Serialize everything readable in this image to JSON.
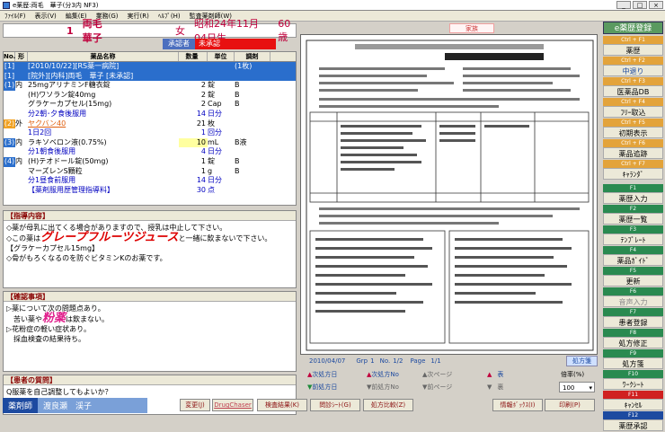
{
  "window": {
    "title": "e薬歴:両毛　華子(分3内 NF3)"
  },
  "menu": [
    "ﾌｧｲﾙ(F)",
    "表示(V)",
    "編集(E)",
    "業務(G)",
    "実行(R)",
    "ﾍﾙﾌﾟ(H)",
    "監査薬剤師(W)"
  ],
  "patient": {
    "id": "1",
    "name": "両毛　華子",
    "sex": "女",
    "birth": "昭和24年11月04日生",
    "age": "60歳",
    "family": "家族"
  },
  "approval": {
    "label": "承認者",
    "status": "未承認"
  },
  "med": {
    "headers": [
      "No.",
      "形",
      "薬品名称",
      "数量",
      "単位",
      "調剤"
    ],
    "rows": [
      {
        "c1": "[1]",
        "c2": "",
        "c3": "[2010/10/22][RS薬一病院]",
        "c4": "",
        "c5": "",
        "c6": "(1枚)",
        "cls": "rp"
      },
      {
        "c1": "[1]",
        "c2": "",
        "c3": "[院外][内科]両毛　華子 [未承認]",
        "c4": "",
        "c5": "",
        "c6": "",
        "cls": "rp"
      },
      {
        "c1": "(1)",
        "c2": "内",
        "c3": "25mgアリナミンF糖衣錠",
        "c4": "2",
        "c5": "錠",
        "c6": "B",
        "cls": ""
      },
      {
        "c1": "",
        "c2": "",
        "c3": "(H)ワソラン錠40mg",
        "c4": "2",
        "c5": "錠",
        "c6": "B",
        "cls": ""
      },
      {
        "c1": "",
        "c2": "",
        "c3": "グラケーカプセル(15mg)",
        "c4": "2",
        "c5": "Cap",
        "c6": "B",
        "cls": ""
      },
      {
        "c1": "",
        "c2": "",
        "c3": "分2朝･夕食後服用",
        "c4": "14",
        "c5": "日分",
        "c6": "",
        "cls": "bl"
      },
      {
        "c1": "(2)",
        "c2": "外",
        "c3": "ヤクバン40",
        "c4": "21",
        "c5": "枚",
        "c6": "",
        "cls": "rp2"
      },
      {
        "c1": "",
        "c2": "",
        "c3": "1日2回",
        "c4": "1",
        "c5": "回分",
        "c6": "",
        "cls": "bl"
      },
      {
        "c1": "(3)",
        "c2": "内",
        "c3": "ラキソベロン液(0.75%)",
        "c4": "10",
        "c5": "mL",
        "c6": "B液",
        "cls": ""
      },
      {
        "c1": "",
        "c2": "",
        "c3": "分1朝食後服用",
        "c4": "4",
        "c5": "日分",
        "c6": "",
        "cls": "bl"
      },
      {
        "c1": "(4)",
        "c2": "内",
        "c3": "(H)テオドール錠(50mg)",
        "c4": "1",
        "c5": "錠",
        "c6": "B",
        "cls": ""
      },
      {
        "c1": "",
        "c2": "",
        "c3": "マーズレンS顆粒",
        "c4": "1",
        "c5": "g",
        "c6": "B",
        "cls": ""
      },
      {
        "c1": "",
        "c2": "",
        "c3": "分1昼食前服用",
        "c4": "14",
        "c5": "日分",
        "c6": "",
        "cls": "bl"
      },
      {
        "c1": "",
        "c2": "",
        "c3": "【薬剤服用歴管理指導料】",
        "c4": "30",
        "c5": "点",
        "c6": "",
        "cls": "bl"
      }
    ]
  },
  "guidance": {
    "title": "【指導内容】",
    "l1": "◇薬が母乳に出てくる場合がありますので、授乳は中止して下さい。",
    "l2a": "◇この薬は",
    "l2b": "グレープフルーツジュース",
    "l2c": "と一緒に飲まないで下さい。",
    "l3": "【グラケーカプセル15mg】",
    "l4": "◇骨がもろくなるのを防ぐビタミンKのお薬です。"
  },
  "check": {
    "title": "【確認事項】",
    "l1": "▷薬について次の問題点あり。",
    "l2a": "苦い薬や",
    "l2b": "粉薬",
    "l2c": "は飲まない。",
    "l3": "▷花粉症の軽い症状あり。",
    "l4": "採血検査の結果待ち。"
  },
  "question": {
    "title": "【患者の質問】",
    "l1": "Q服薬を自己調整してもよいか？",
    "l2": "A医師の指示通り、服薬を続けてください。"
  },
  "pharmacist": {
    "label": "薬剤師",
    "name": "渡良瀬　渓子"
  },
  "bottom": [
    "変更(J)",
    "DrugChaser",
    "検査結果(K)",
    "問診ｼｰﾄ(G)",
    "処方比較(Z)",
    "情報ﾎﾞｯｸｽ(I)",
    "印刷(P)"
  ],
  "rx": {
    "date": "2010/04/07",
    "grp_label": "Grp",
    "grp": "1",
    "no_label": "No.",
    "no": "1/2",
    "page_label": "Page",
    "page": "1/1",
    "rx_label": "処方箋"
  },
  "nav": {
    "next_rx": "次処方日",
    "next_no": "次処方No",
    "next_page": "次ページ",
    "prev_rx": "前処方日",
    "prev_no": "前処方No",
    "prev_page": "前ページ",
    "front": "表",
    "back": "裏",
    "zoom_label": "倍率(%)",
    "zoom": "100"
  },
  "sidebar": {
    "title": "e薬歴登録",
    "keys": [
      {
        "k": "Ctrl + F1",
        "l": "薬歴"
      },
      {
        "k": "Ctrl + F2",
        "l": "中退り"
      },
      {
        "k": "Ctrl + F3",
        "l": "医薬品DB"
      },
      {
        "k": "Ctrl + F4",
        "l": "ﾌﾘｰ取込"
      },
      {
        "k": "Ctrl + F5",
        "l": "初期表示"
      },
      {
        "k": "Ctrl + F6",
        "l": "薬品追跡"
      },
      {
        "k": "Ctrl + F7",
        "l": "ｷｬﾗﾝﾀﾞ"
      }
    ],
    "fkeys": [
      {
        "k": "F1",
        "l": "薬歴入力"
      },
      {
        "k": "F2",
        "l": "薬歴一覧"
      },
      {
        "k": "F3",
        "l": "ﾃﾝﾌﾟﾚｰﾄ"
      },
      {
        "k": "F4",
        "l": "薬品ｶﾞｲﾄﾞ"
      },
      {
        "k": "F5",
        "l": "更新"
      },
      {
        "k": "F6",
        "l": "音声入力"
      },
      {
        "k": "F7",
        "l": "患者登録"
      },
      {
        "k": "F8",
        "l": "処方修正"
      },
      {
        "k": "F9",
        "l": "処方箋"
      },
      {
        "k": "F10",
        "l": "ﾜｰｸｼｰﾄ"
      },
      {
        "k": "F11",
        "l": "ｷｬﾝｾﾙ"
      },
      {
        "k": "F12",
        "l": "薬歴承認"
      }
    ]
  }
}
